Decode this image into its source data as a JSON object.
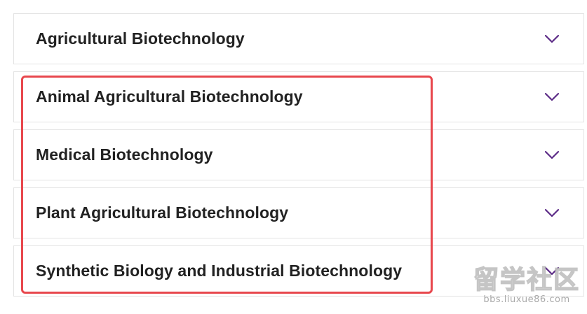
{
  "accordion": {
    "items": [
      {
        "label": "Agricultural Biotechnology",
        "icon": "chevron-down-icon"
      },
      {
        "label": "Animal Agricultural Biotechnology",
        "icon": "chevron-down-icon"
      },
      {
        "label": "Medical Biotechnology",
        "icon": "chevron-down-icon"
      },
      {
        "label": "Plant Agricultural Biotechnology",
        "icon": "chevron-down-icon"
      },
      {
        "label": "Synthetic Biology and Industrial Biotechnology",
        "icon": "chevron-down-icon"
      }
    ]
  },
  "colors": {
    "chevron": "#5b2a86",
    "highlight_border": "#e8474d",
    "item_border": "#e3e3e3",
    "label_text": "#222222"
  },
  "watermark": {
    "logo_text": "留学社区",
    "url": "bbs.liuxue86.com"
  }
}
